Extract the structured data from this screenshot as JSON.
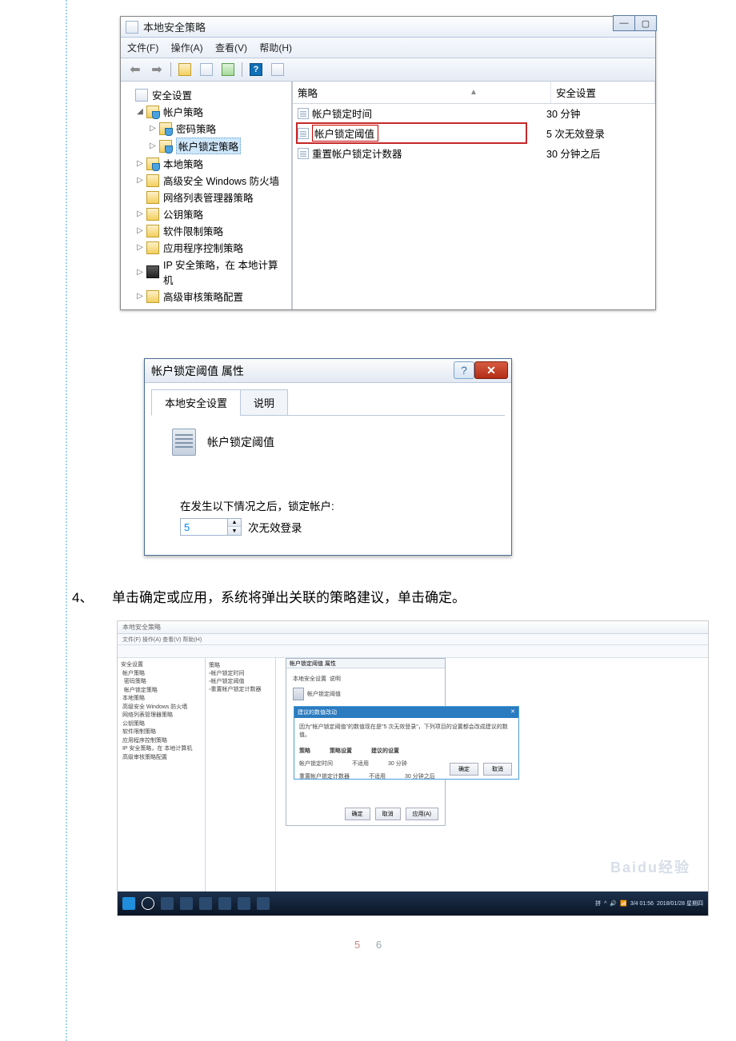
{
  "window1": {
    "title": "本地安全策略",
    "menubar": {
      "file": "文件(F)",
      "action": "操作(A)",
      "view": "查看(V)",
      "help": "帮助(H)"
    },
    "tree": {
      "root": "安全设置",
      "account": "帐户策略",
      "password": "密码策略",
      "lockout": "帐户锁定策略",
      "local": "本地策略",
      "firewall": "高级安全 Windows 防火墙",
      "netlist": "网络列表管理器策略",
      "pubkey": "公钥策略",
      "software": "软件限制策略",
      "appctrl": "应用程序控制策略",
      "ipsec": "IP 安全策略，在 本地计算机",
      "audit": "高级审核策略配置"
    },
    "list": {
      "header": {
        "policy": "策略",
        "security": "安全设置"
      },
      "rows": [
        {
          "name": "帐户锁定时间",
          "value": "30 分钟"
        },
        {
          "name": "帐户锁定阈值",
          "value": "5 次无效登录",
          "selected": true
        },
        {
          "name": "重置帐户锁定计数器",
          "value": "30 分钟之后"
        }
      ]
    }
  },
  "dialog": {
    "title": "帐户锁定阈值 属性",
    "tabs": {
      "local": "本地安全设置",
      "explain": "说明"
    },
    "heading": "帐户锁定阈值",
    "description": "在发生以下情况之后，锁定帐户:",
    "value": "5",
    "suffix": "次无效登录"
  },
  "step4": {
    "number": "4、",
    "text": "单击确定或应用，系统将弹出关联的策略建议，单击确定。"
  },
  "shot3": {
    "title": "本地安全策略",
    "menubar": "文件(F)  操作(A)  查看(V)  帮助(H)",
    "dlg_title": "帐户锁定阈值 属性",
    "dlg_tab1": "本地安全设置",
    "dlg_tab2": "说明",
    "dlg_heading": "帐户锁定阈值",
    "inner_title": "建议的数值改动",
    "inner_text": "因为\"帐户锁定阈值\"的数值现在是\"5 次无效登录\"，下列项目的设置都会改成建议的数值。",
    "inner_h_policy": "策略",
    "inner_h_cur": "策略设置",
    "inner_h_sug": "建议的设置",
    "inner_r1_p": "帐户锁定时间",
    "inner_r1_c": "不适用",
    "inner_r1_s": "30 分钟",
    "inner_r2_p": "重置帐户锁定计数器",
    "inner_r2_c": "不适用",
    "inner_r2_s": "30 分钟之后",
    "btn_ok": "确定",
    "btn_cancel": "取消",
    "btn_apply": "应用(A)",
    "watermark": "Baidu经验",
    "tray_time": "3/4 01:56",
    "tray_date": "2018/01/28 星期四"
  },
  "pager": {
    "p1": "5",
    "p2": "6"
  }
}
